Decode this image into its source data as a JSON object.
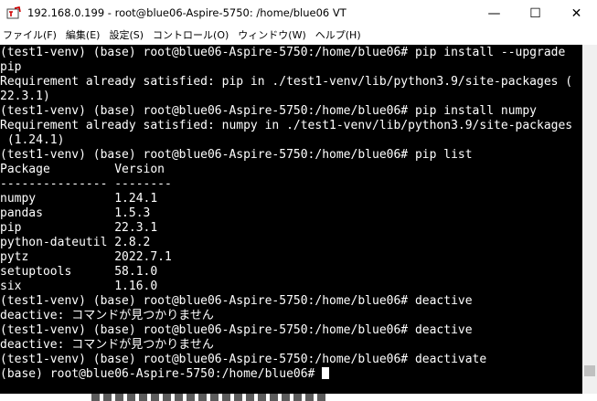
{
  "window": {
    "title": "192.168.0.199 - root@blue06-Aspire-5750: /home/blue06 VT",
    "icons": {
      "app": "teraterm-icon",
      "minimize": "minimize-icon",
      "maximize": "maximize-icon",
      "close": "close-icon"
    },
    "minimize_glyph": "—",
    "maximize_glyph": "☐",
    "close_glyph": "✕"
  },
  "menu": [
    "ファイル(F)",
    "編集(E)",
    "設定(S)",
    "コントロール(O)",
    "ウィンドウ(W)",
    "ヘルプ(H)"
  ],
  "terminal": {
    "colors": {
      "background": "#000000",
      "foreground": "#ffffff"
    },
    "lines": [
      "(test1-venv) (base) root@blue06-Aspire-5750:/home/blue06# pip install --upgrade",
      "pip",
      "Requirement already satisfied: pip in ./test1-venv/lib/python3.9/site-packages (",
      "22.3.1)",
      "(test1-venv) (base) root@blue06-Aspire-5750:/home/blue06# pip install numpy",
      "Requirement already satisfied: numpy in ./test1-venv/lib/python3.9/site-packages",
      " (1.24.1)",
      "(test1-venv) (base) root@blue06-Aspire-5750:/home/blue06# pip list",
      "Package         Version",
      "--------------- --------",
      "numpy           1.24.1",
      "pandas          1.5.3",
      "pip             22.3.1",
      "python-dateutil 2.8.2",
      "pytz            2022.7.1",
      "setuptools      58.1.0",
      "six             1.16.0",
      "(test1-venv) (base) root@blue06-Aspire-5750:/home/blue06# deactive",
      "deactive: コマンドが見つかりません",
      "(test1-venv) (base) root@blue06-Aspire-5750:/home/blue06# deactive",
      "deactive: コマンドが見つかりません",
      "(test1-venv) (base) root@blue06-Aspire-5750:/home/blue06# deactivate",
      "(base) root@blue06-Aspire-5750:/home/blue06# "
    ]
  }
}
